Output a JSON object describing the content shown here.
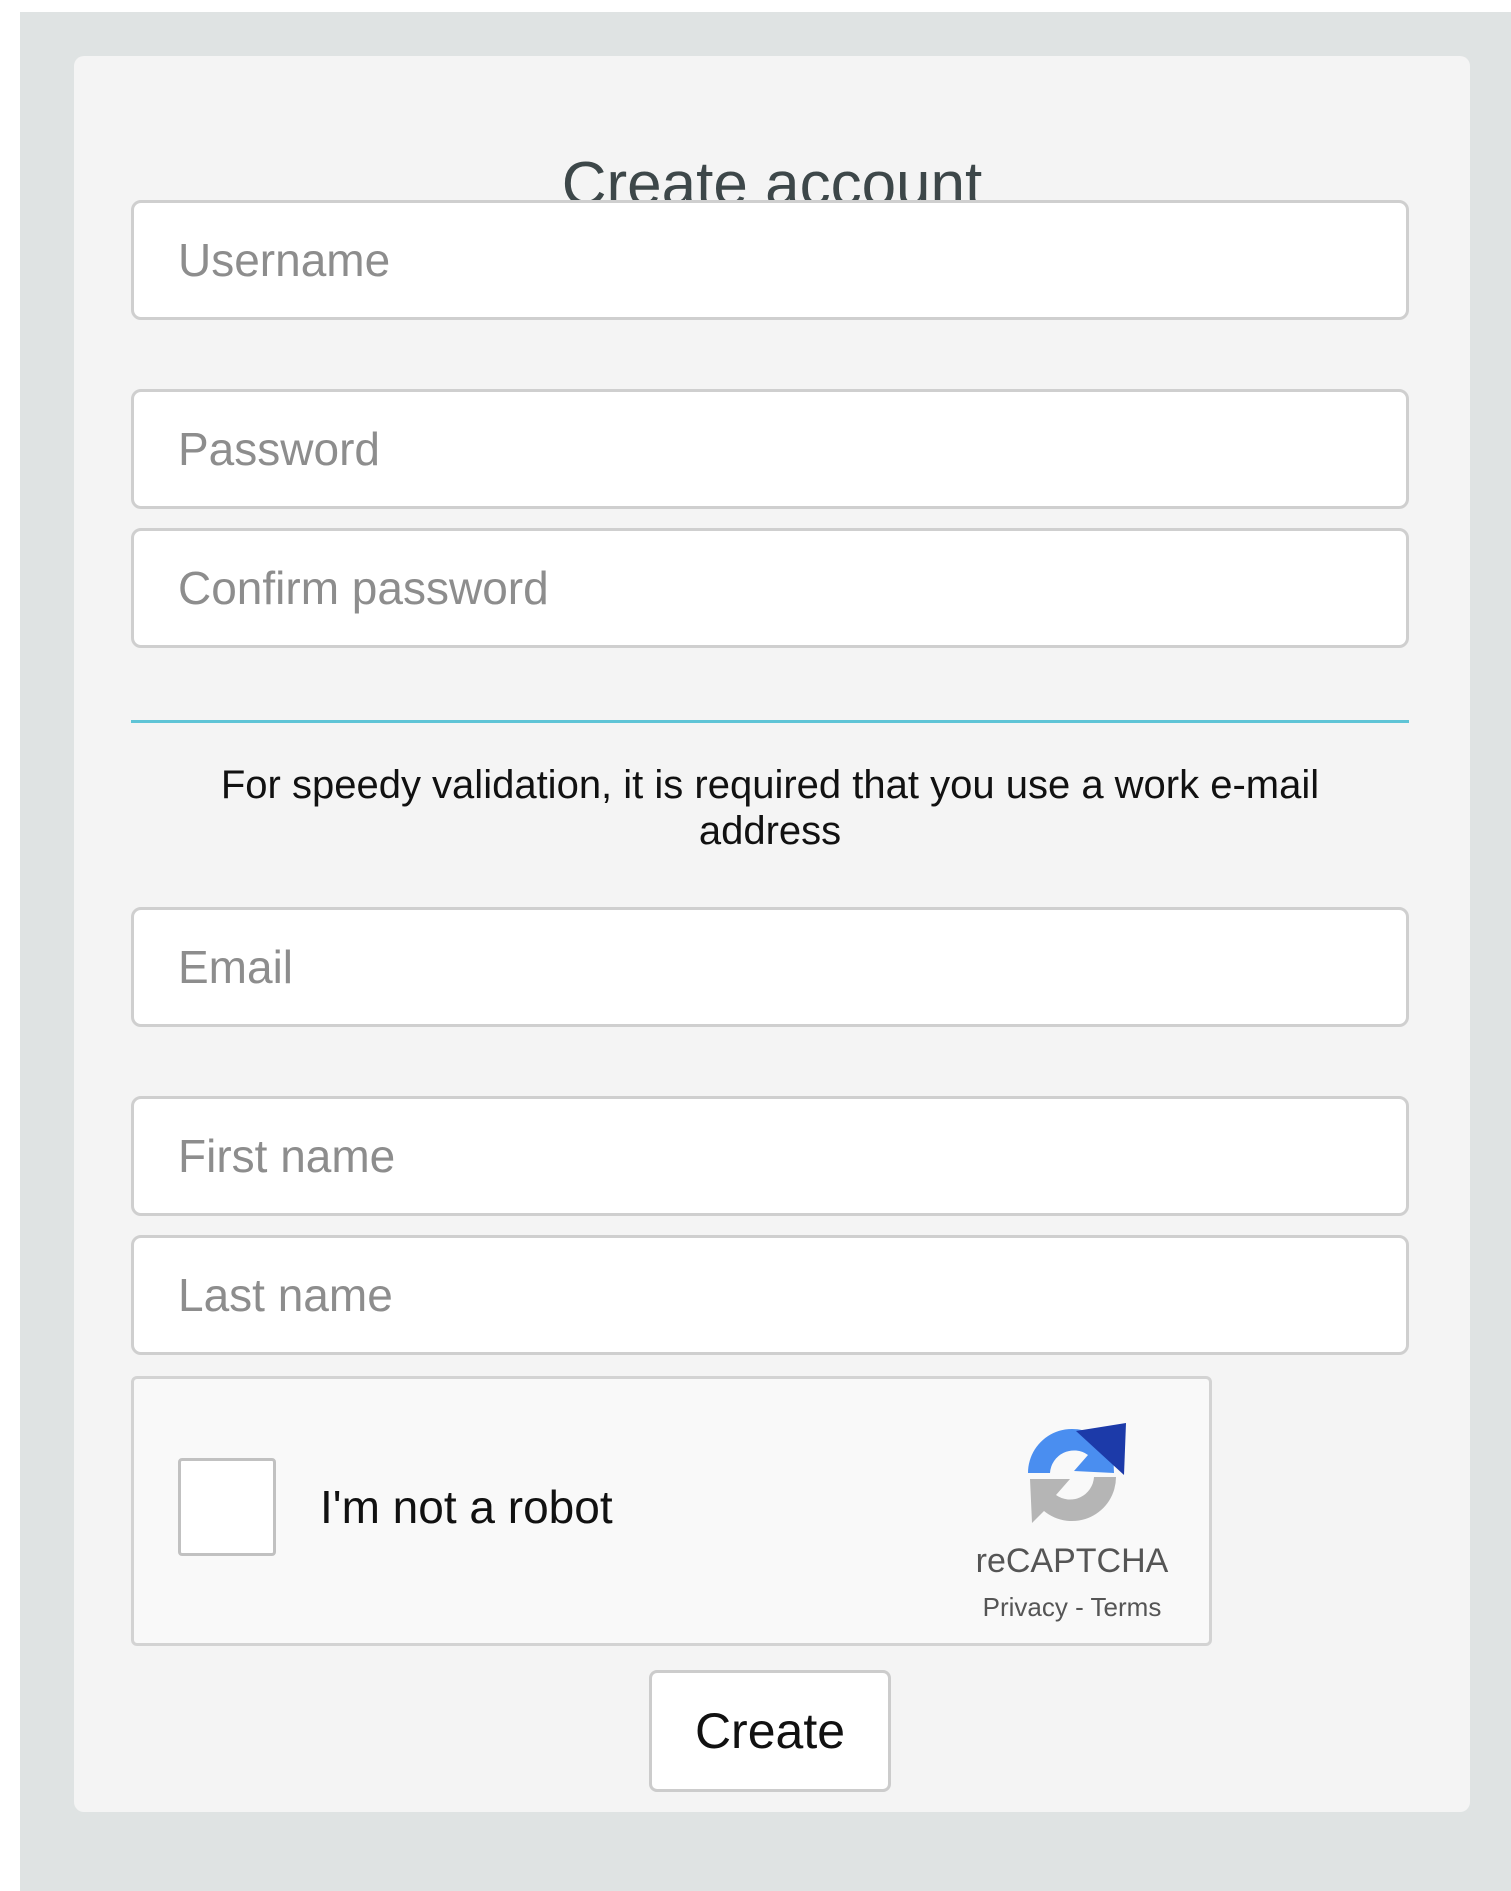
{
  "form": {
    "title": "Create account",
    "username_placeholder": "Username",
    "password_placeholder": "Password",
    "confirm_password_placeholder": "Confirm password",
    "notice_line1": "For speedy validation, it is required that you use a work e-mail",
    "notice_line2": "address",
    "email_placeholder": "Email",
    "first_name_placeholder": "First name",
    "last_name_placeholder": "Last name",
    "submit_label": "Create"
  },
  "captcha": {
    "label": "I'm not a robot",
    "brand": "reCAPTCHA",
    "privacy_label": "Privacy",
    "separator": " - ",
    "terms_label": "Terms",
    "checked": false,
    "logo_icon": "recaptcha-logo-icon"
  },
  "colors": {
    "accent_divider": "#5fc4d6",
    "page_background": "#dfe3e3",
    "card_background": "#f4f4f4"
  }
}
